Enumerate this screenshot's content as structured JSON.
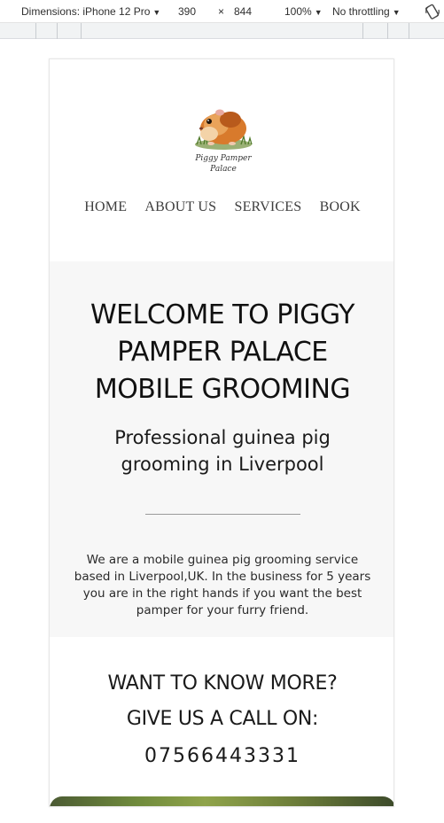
{
  "devtools": {
    "dimensions_label": "Dimensions: iPhone 12 Pro",
    "width": "390",
    "times": "×",
    "height": "844",
    "zoom": "100%",
    "throttling": "No throttling"
  },
  "site": {
    "logo_text": "Piggy Pamper Palace",
    "nav": [
      "HOME",
      "ABOUT US",
      "SERVICES",
      "BOOK"
    ],
    "hero": {
      "title": "WELCOME TO PIGGY PAMPER PALACE MOBILE GROOMING",
      "subtitle": "Professional guinea pig grooming in Liverpool",
      "body": "We are a mobile guinea pig grooming service based in Liverpool,UK. In the business for 5 years you are in the right hands if you want the best pamper for your furry friend."
    },
    "contact": {
      "line1": "WANT TO KNOW MORE?",
      "line2": "GIVE US A CALL ON:",
      "phone": "07566443331"
    }
  },
  "colors": {
    "hero_bg": "#f7f7f7",
    "text": "#1a1a1a",
    "nav_text": "#3d3d3d"
  }
}
